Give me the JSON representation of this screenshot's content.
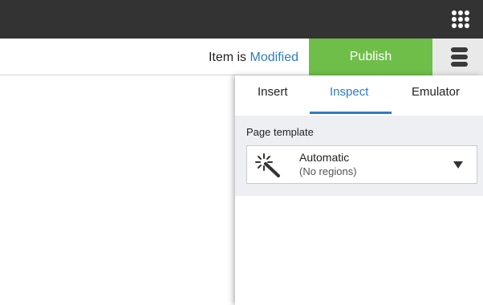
{
  "header": {
    "apps_icon": "grid-apps-icon"
  },
  "status": {
    "prefix": "Item is",
    "state": "Modified",
    "publish_label": "Publish",
    "menu_icon": "stack-menu-icon"
  },
  "panel": {
    "tabs": [
      {
        "label": "Insert"
      },
      {
        "label": "Inspect",
        "active": true
      },
      {
        "label": "Emulator"
      }
    ],
    "page_template": {
      "label": "Page template",
      "value": "Automatic",
      "subtitle": "(No regions)",
      "icon": "magic-wand-icon"
    }
  },
  "colors": {
    "accent": "#2f7cc1",
    "publish": "#6fbe4a",
    "topbar": "#333333"
  }
}
